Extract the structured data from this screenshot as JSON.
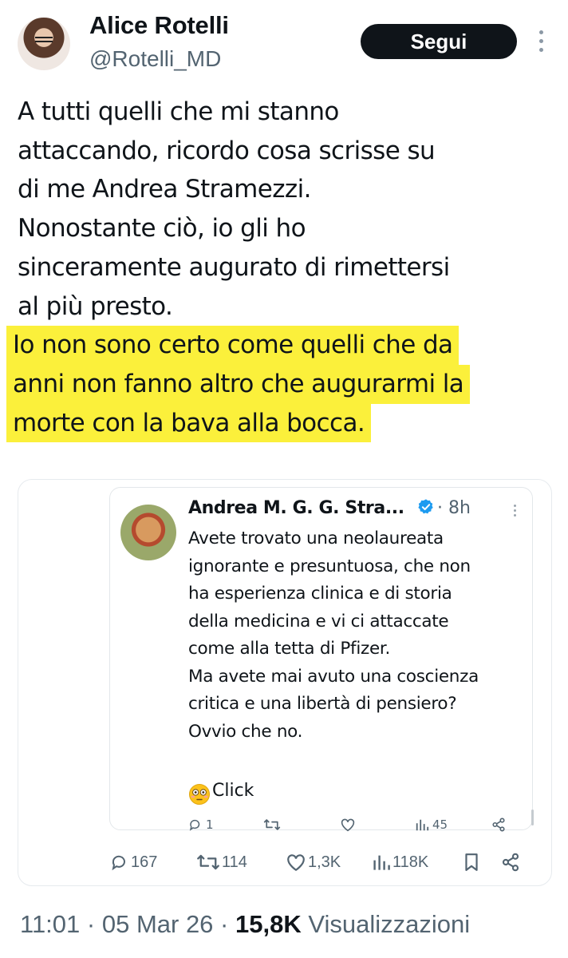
{
  "author": {
    "name": "Alice Rotelli",
    "handle": "@Rotelli_MD",
    "follow_label": "Segui"
  },
  "tweet": {
    "lines": [
      "A tutti quelli che mi stanno",
      "attaccando, ricordo cosa scrisse su",
      "di me Andrea Stramezzi.",
      "Nonostante ciò, io gli ho",
      "sinceramente augurato di rimettersi",
      "al più presto."
    ],
    "highlighted_lines": [
      "Io non sono certo come quelli che da",
      "anni non fanno altro che augurarmi la",
      "morte con la bava alla bocca."
    ],
    "highlight_color": "#fbf03b"
  },
  "quoted": {
    "name": "Andrea M. G. G. Stra...",
    "time": "· 8h",
    "lines": [
      "Avete trovato una neolaureata",
      "ignorante e presuntuosa, che non",
      "ha esperienza clinica e di storia",
      "della medicina e vi ci attaccate",
      "come alla tetta di Pfizer.",
      "Ma avete mai avuto una coscienza",
      "critica e una libertà di pensiero?",
      "Ovvio che no."
    ],
    "click_text": "Click",
    "emoji_icon": "flushed-face-emoji",
    "actions": {
      "replies": "1",
      "views": "45"
    }
  },
  "actions": {
    "replies": "167",
    "reposts": "114",
    "likes": "1,3K",
    "views": "118K"
  },
  "meta": {
    "time": "11:01",
    "date": "05 Mar 26",
    "views_count": "15,8K",
    "views_label": "Visualizzazioni"
  },
  "colors": {
    "text": "#0f1419",
    "secondary": "#536471",
    "verified": "#1d9bf0",
    "follow_bg": "#0f1419"
  }
}
